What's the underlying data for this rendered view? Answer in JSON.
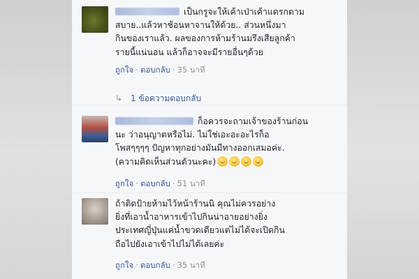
{
  "comments": [
    {
      "text": "เป็นกรูจะให้เค้าเป่าเค้าแดรกตาม\nสบาย..แล้วหาช้อนหาจานให้ด้วย.. ส่วนหนึ่งมา\nกินของเราแล้ว. ผลของการห้ามร้านมรึงเสียลูกค้า\nรายนี้แน่นอน แล้วก็อาจจะมีรายอื่นๆด้วย",
      "like": "ถูกใจ",
      "reply": "ตอบกลับ",
      "time": "35 นาที"
    },
    {
      "text": "ก็อควรจะถามเจ้าของร้านก่อน\nนะ ว่าอนุญาตหรือไม่. ไม่ใช่เอะอะอะไรก็อ\nโพสๆๆๆๆ ปัญหาทุกอย่างมันมีทางออกเสมอค่ะ.\n(ความคิดเห็นส่วนตัวนะคะ)",
      "like": "ถูกใจ",
      "reply": "ตอบกลับ",
      "time": "51 นาที"
    },
    {
      "text": "ถ้าติดป้ายห้ามไว้หน้าร้านนิ คุณไม่ควรอย่าง\nยิ่งที่เอาน้ำอาหารเข้าไปกินน่าอายอย่างยิ่ง\nประเทศญี่ปุ่นแค่น้ำขวดเดียวแต่ไม่ได้จะเปิดกิน\nถือไปยังเอาเข้าไปไม่ได้เลยค่ะ",
      "like": "ถูกใจ",
      "reply": "ตอบกลับ",
      "time": "35 นาที"
    }
  ],
  "replies_link": "1 ข้อความตอบกลับ",
  "icons": {
    "reply_arrow": "reply-arrow-icon",
    "emoji": "smiling-face-emoji-icon"
  },
  "colors": {
    "link": "#365899",
    "meta": "#90949c",
    "text": "#1d2129",
    "panel": "#f6f7f9"
  }
}
